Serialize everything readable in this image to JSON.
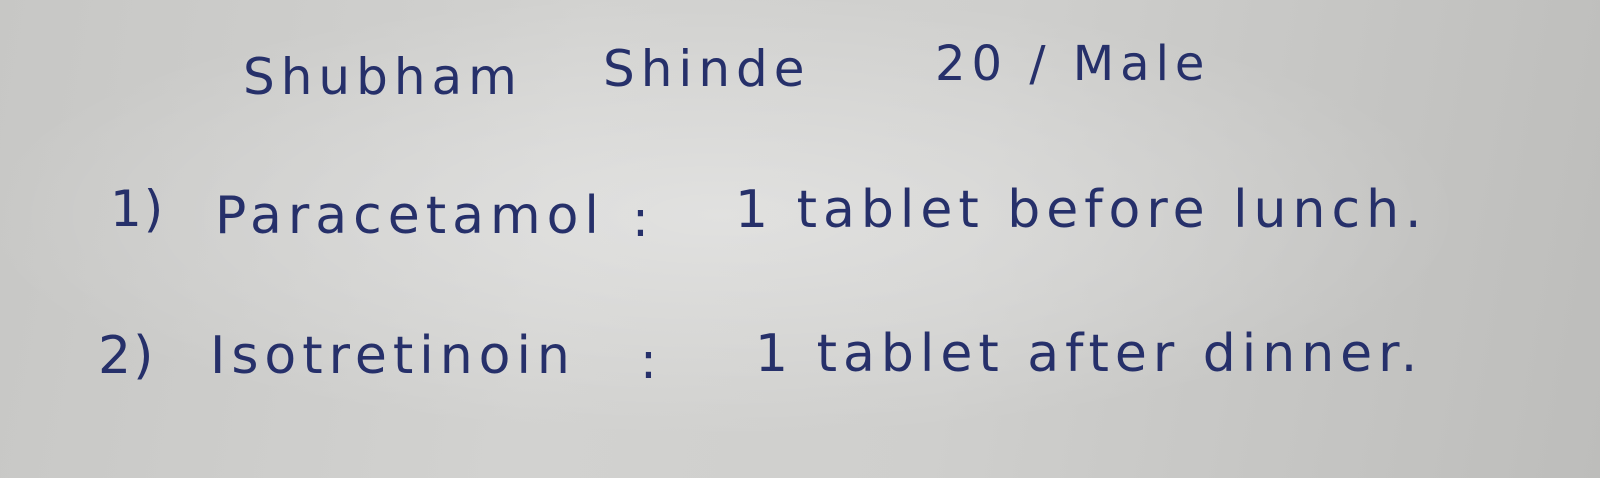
{
  "patient": {
    "first_name": "Shubham",
    "last_name": "Shinde",
    "age_sex": "20 / Male"
  },
  "prescriptions": [
    {
      "number": "1)",
      "drug": "Paracetamol",
      "separator": ":",
      "instruction": "1 tablet before lunch."
    },
    {
      "number": "2)",
      "drug": "Isotretinoin",
      "separator": ":",
      "instruction": "1 tablet after dinner."
    }
  ],
  "colors": {
    "ink": "#26306a",
    "paper": "#cfcfcd"
  }
}
